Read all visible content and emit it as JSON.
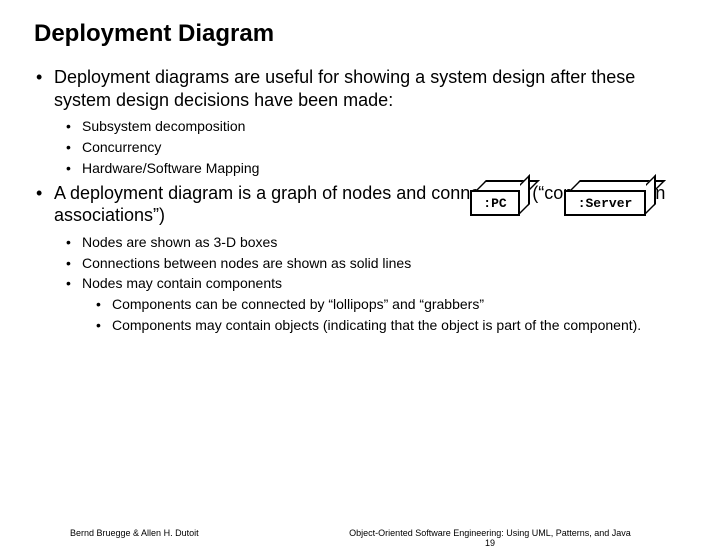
{
  "title": "Deployment Diagram",
  "bullets": {
    "p1": "Deployment diagrams are useful for showing a system design after these system design decisions have been made:",
    "p1_subs": [
      "Subsystem decomposition",
      "Concurrency",
      "Hardware/Software Mapping"
    ],
    "p2": "A deployment diagram is a graph of nodes and connections (“communication associations”)",
    "p2_subs": [
      "Nodes are shown as 3-D boxes",
      "Connections  between nodes are shown as solid lines",
      "Nodes may contain components"
    ],
    "p2_subsubs": [
      "Components can be connected by “lollipops” and “grabbers”",
      "Components may contain objects (indicating that the object is part of the component)."
    ]
  },
  "diagram": {
    "pc_label": ":PC",
    "server_label": ":Server"
  },
  "footer": {
    "left": "Bernd Bruegge & Allen H. Dutoit",
    "right": "Object-Oriented Software Engineering: Using UML, Patterns, and Java",
    "page": "19"
  }
}
